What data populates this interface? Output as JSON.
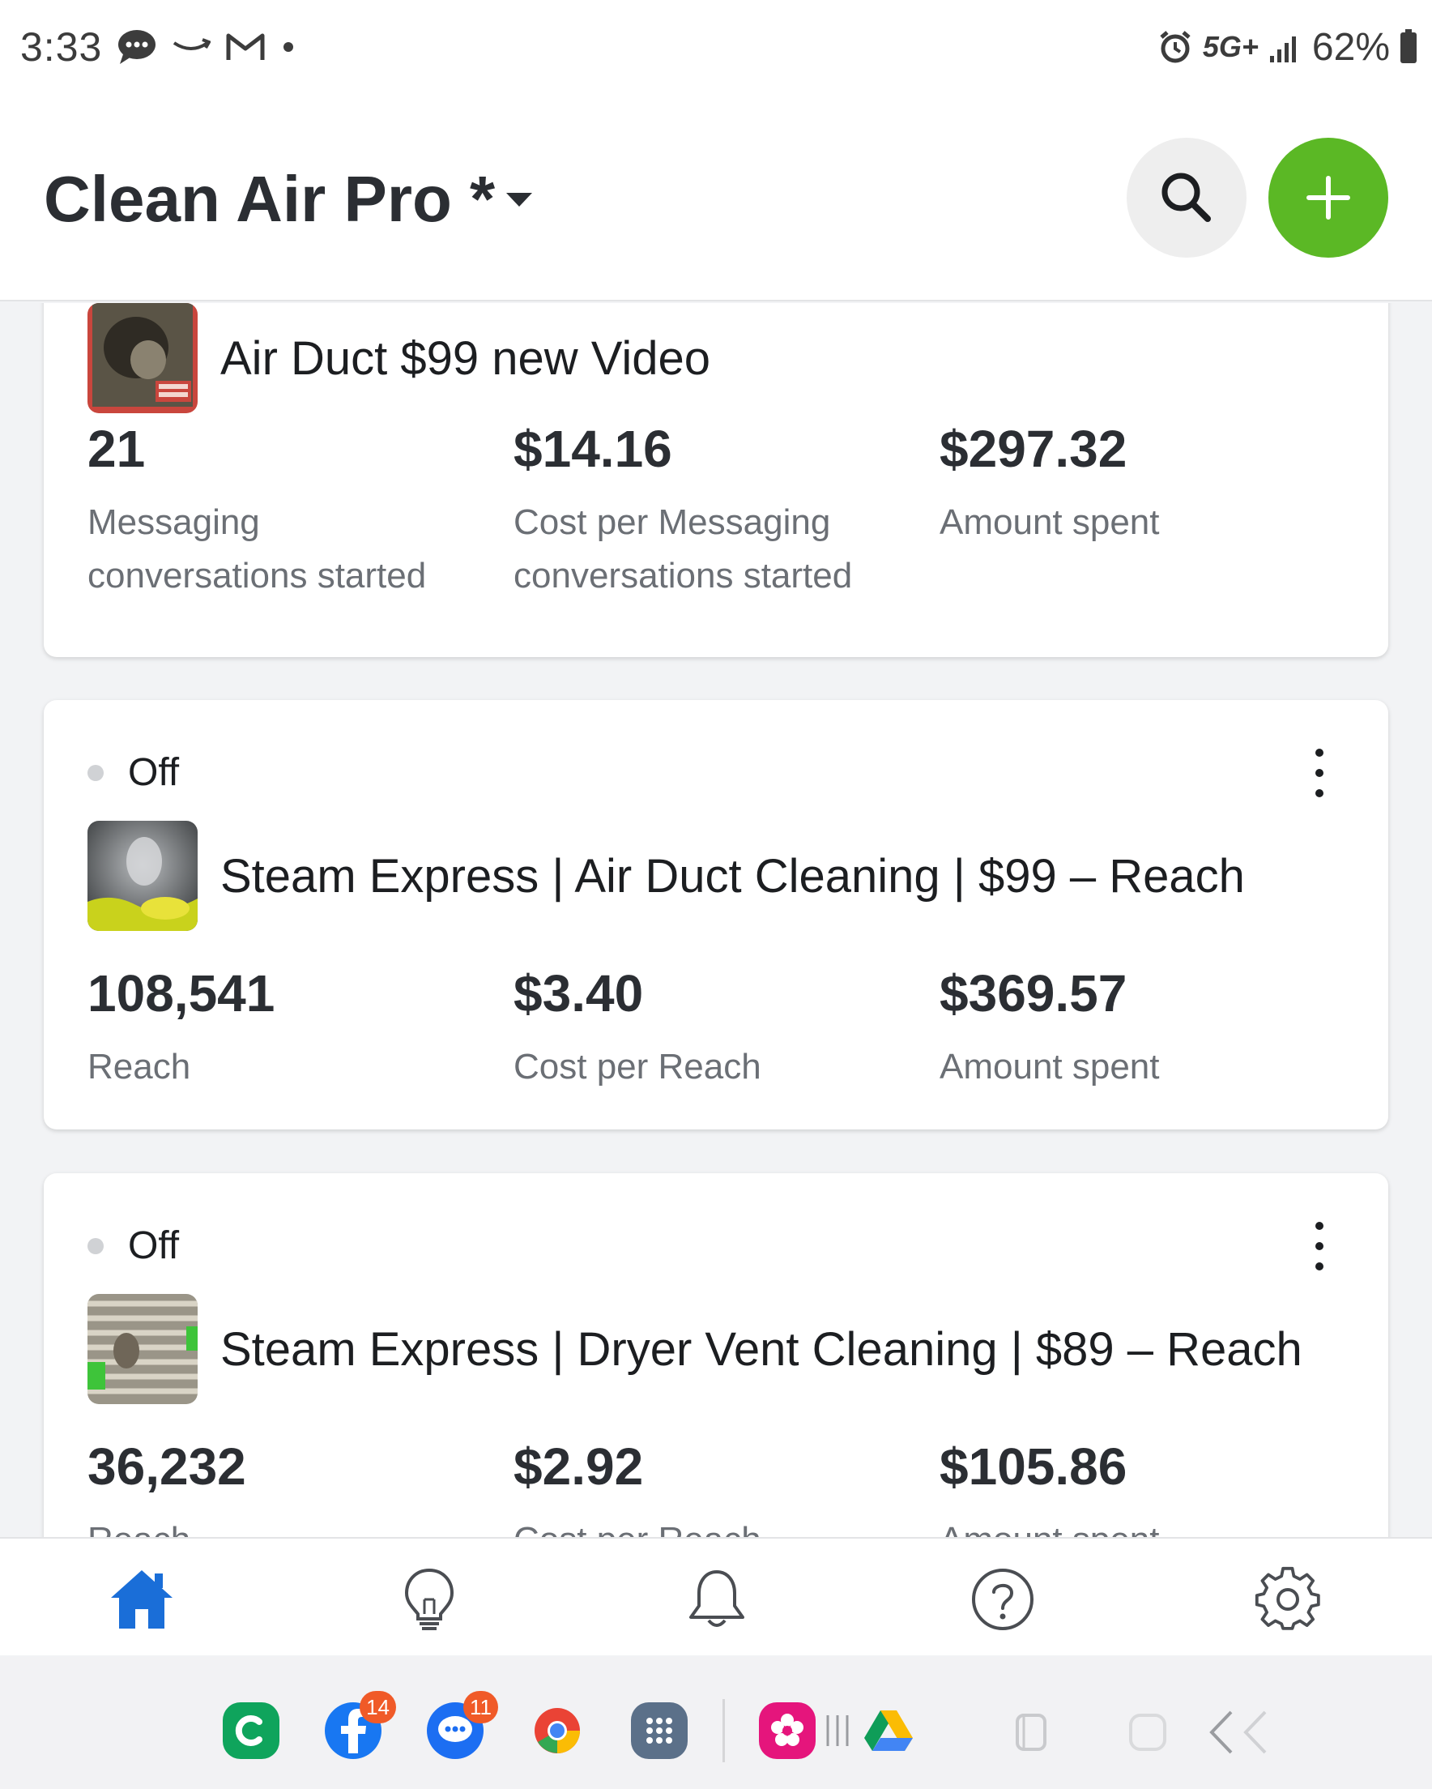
{
  "status_bar": {
    "time": "3:33",
    "network": "5G+",
    "battery": "62%",
    "left_icons": [
      "chat-bubble-icon",
      "amazon-icon",
      "gmail-icon",
      "dot-icon"
    ],
    "right_icons": [
      "alarm-icon",
      "signal-icon",
      "battery-icon"
    ]
  },
  "header": {
    "account_name": "Clean Air Pro *",
    "search_icon": "search-icon",
    "add_icon": "plus-icon",
    "accent_color": "#5bb825"
  },
  "ads": [
    {
      "status": "",
      "name": "Air Duct $99 new Video",
      "metrics": [
        {
          "value": "21",
          "label": "Messaging conversations started"
        },
        {
          "value": "$14.16",
          "label": "Cost per Messaging conversations started"
        },
        {
          "value": "$297.32",
          "label": "Amount spent"
        }
      ]
    },
    {
      "status": "Off",
      "name": "Steam Express | Air Duct Cleaning | $99 – Reach",
      "metrics": [
        {
          "value": "108,541",
          "label": "Reach"
        },
        {
          "value": "$3.40",
          "label": "Cost per Reach"
        },
        {
          "value": "$369.57",
          "label": "Amount spent"
        }
      ]
    },
    {
      "status": "Off",
      "name": "Steam Express | Dryer Vent Cleaning | $89 – Reach",
      "metrics": [
        {
          "value": "36,232",
          "label": "Reach"
        },
        {
          "value": "$2.92",
          "label": "Cost per Reach"
        },
        {
          "value": "$105.86",
          "label": "Amount spent"
        }
      ]
    }
  ],
  "bottom_nav": {
    "items": [
      "home-icon",
      "lightbulb-icon",
      "bell-icon",
      "help-icon",
      "settings-icon"
    ],
    "active": "home-icon",
    "active_color": "#1a6ed8"
  },
  "dock": {
    "apps": [
      "c-app-icon",
      "facebook-icon",
      "messages-icon",
      "chrome-icon",
      "app-drawer-icon",
      "flower-app-icon",
      "google-drive-icon"
    ],
    "facebook_badge": "14",
    "messages_badge": "11"
  }
}
